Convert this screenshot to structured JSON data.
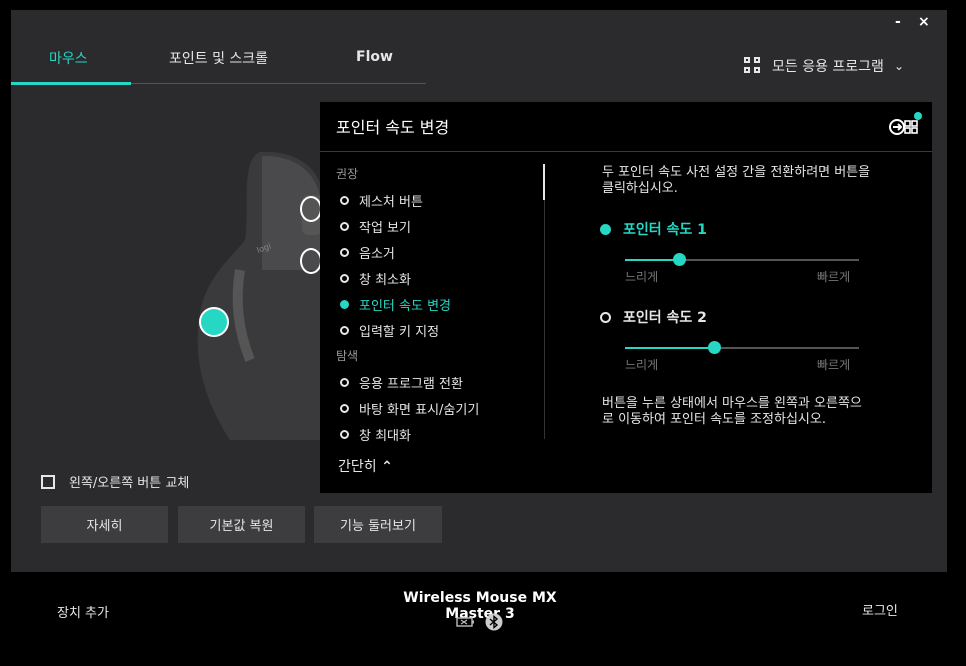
{
  "window": {
    "minimize": "-",
    "close": "×"
  },
  "tabs": [
    {
      "label": "마우스",
      "active": true
    },
    {
      "label": "포인트 및 스크롤",
      "active": false
    },
    {
      "label": "Flow",
      "active": false
    }
  ],
  "app_selector": {
    "label": "모든 응용 프로그램",
    "icon": "grid-icon",
    "chevron": "chevron-down-icon"
  },
  "mouse_graphic": {
    "logo_text": "logi"
  },
  "panel": {
    "title": "포인터 속도 변경",
    "corner_icon": "pointer-speed-icon",
    "categories": [
      {
        "label": "권장",
        "items": [
          "제스처 버튼",
          "작업 보기",
          "음소거",
          "창 최소화",
          "포인터 속도 변경",
          "입력할 키 지정"
        ]
      },
      {
        "label": "탐색",
        "items": [
          "응용 프로그램 전환",
          "바탕 화면 표시/숨기기",
          "창 최대화"
        ]
      }
    ],
    "selected_item": "포인터 속도 변경",
    "description": "두 포인터 속도 사전 설정 간을 전환하려면 버튼을 클릭하십시오.",
    "speeds": [
      {
        "label": "포인터 속도 1",
        "selected": true,
        "slider_value": 0.23,
        "slow": "느리게",
        "fast": "빠르게"
      },
      {
        "label": "포인터 속도 2",
        "selected": false,
        "slider_value": 0.38,
        "slow": "느리게",
        "fast": "빠르게"
      }
    ],
    "note": "버튼을 누른 상태에서 마우스를 왼쪽과 오른쪽으로 이동하여 포인터 속도를 조정하십시오.",
    "collapse_label": "간단히"
  },
  "swap_buttons": {
    "label": "왼쪽/오른쪽 버튼 교체",
    "checked": false
  },
  "buttons": {
    "details": "자세히",
    "restore": "기본값 복원",
    "tour": "기능 둘러보기"
  },
  "footer": {
    "add_device": "장치 추가",
    "device_name": "Wireless Mouse MX Master 3",
    "login": "로그인"
  },
  "colors": {
    "accent": "#26d7c4",
    "window_bg": "#2b2b2d",
    "panel_bg": "#000000"
  }
}
